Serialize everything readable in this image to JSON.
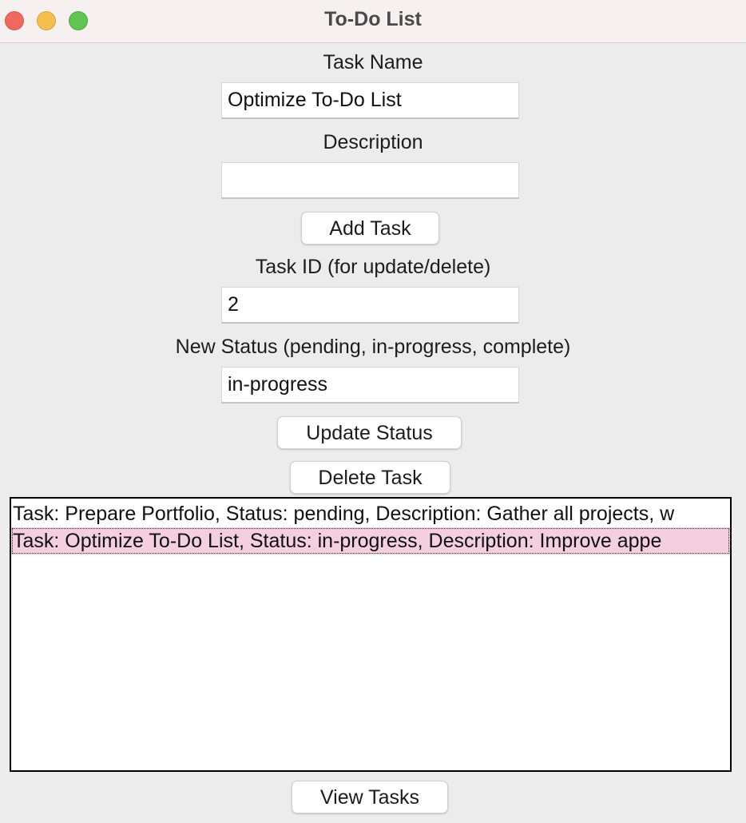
{
  "window": {
    "title": "To-Do List"
  },
  "form": {
    "task_name_label": "Task Name",
    "task_name_value": "Optimize To-Do List",
    "description_label": "Description",
    "description_value": "",
    "add_task_label": "Add Task",
    "task_id_label": "Task ID (for update/delete)",
    "task_id_value": "2",
    "new_status_label": "New Status (pending, in-progress, complete)",
    "new_status_value": "in-progress",
    "update_status_label": "Update Status",
    "delete_task_label": "Delete Task"
  },
  "tasks": {
    "items": [
      {
        "text": "Task: Prepare Portfolio, Status: pending, Description: Gather all projects, w",
        "selected": false
      },
      {
        "text": "Task: Optimize To-Do List, Status: in-progress, Description: Improve appe",
        "selected": true
      }
    ]
  },
  "footer": {
    "view_tasks_label": "View Tasks"
  },
  "colors": {
    "selection": "#f4cfe0",
    "close": "#ee6a5f",
    "minimize": "#f5be4f",
    "maximize": "#61c454"
  }
}
